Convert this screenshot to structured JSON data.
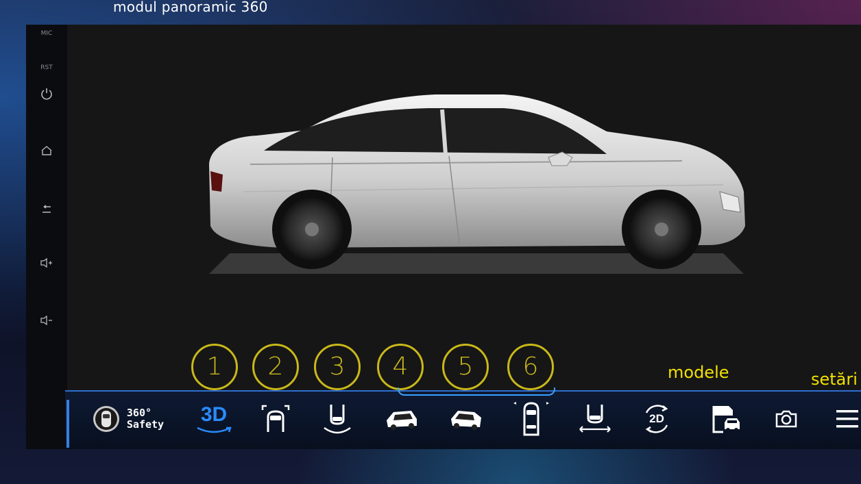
{
  "header": {
    "title": "modul panoramic 360"
  },
  "side_rail": {
    "items": [
      {
        "label": "MIC",
        "icon": "mic-label"
      },
      {
        "label": "RST",
        "icon": "reset-label"
      },
      {
        "icon": "power-icon"
      },
      {
        "icon": "home-icon"
      },
      {
        "icon": "back-icon"
      },
      {
        "icon": "volume-up-icon"
      },
      {
        "icon": "volume-down-icon"
      }
    ]
  },
  "numbers": [
    "1",
    "2",
    "3",
    "4",
    "5",
    "6"
  ],
  "callouts": {
    "models": "modele",
    "settings": "setări",
    "photo": "fotografie"
  },
  "toolbar": {
    "brand_top": "360°",
    "brand_bottom": "Safety",
    "mode_3d": "3D",
    "mode_2d": "2D",
    "icons": [
      "view-3d-icon",
      "front-view-icon",
      "rear-view-icon",
      "left-side-car-icon",
      "right-side-car-icon",
      "top-view-icon",
      "wide-rear-view-icon",
      "toggle-2d-icon",
      "car-models-icon",
      "camera-icon",
      "menu-icon"
    ]
  },
  "colors": {
    "accent": "#2a8bff",
    "highlight": "#f2e000",
    "circle": "#c9b81a",
    "screen": "#161616"
  }
}
